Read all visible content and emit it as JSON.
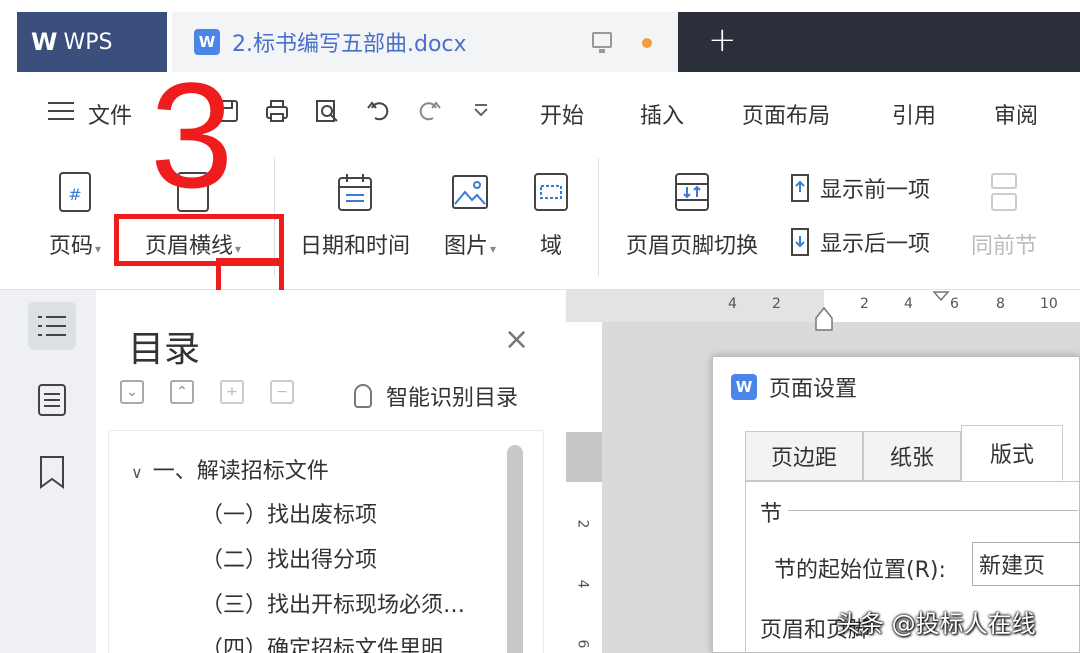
{
  "titlebar": {
    "app_name": "WPS",
    "doc_tab": "2.标书编写五部曲.docx",
    "new_tab": "+"
  },
  "menu": {
    "file": "文件",
    "tabs": [
      "开始",
      "插入",
      "页面布局",
      "引用",
      "审阅"
    ]
  },
  "ribbon": {
    "page_number": "页码",
    "header_line": "页眉横线",
    "date_time": "日期和时间",
    "picture": "图片",
    "field": "域",
    "header_footer_switch": "页眉页脚切换",
    "show_prev": "显示前一项",
    "show_next": "显示后一项",
    "same_as_prev": "同前节"
  },
  "annotation": {
    "step": "3"
  },
  "toc": {
    "title": "目录",
    "close": "×",
    "smart_toc": "智能识别目录",
    "items": [
      "一、解读招标文件",
      "（一）找出废标项",
      "（二）找出得分项",
      "（三）找出开标现场必须…",
      "（四）确定招标文件里明…"
    ]
  },
  "ruler": {
    "h_ticks": [
      "4",
      "2",
      "2",
      "4",
      "6",
      "8",
      "10"
    ],
    "v_ticks": [
      "2",
      "4",
      "6"
    ]
  },
  "dialog": {
    "title": "页面设置",
    "tabs": [
      "页边距",
      "纸张",
      "版式"
    ],
    "active_tab": "版式",
    "section": "节",
    "start_label": "节的起始位置(R):",
    "start_value": "新建页",
    "section2": "页眉和页脚"
  },
  "watermark": "头条 @投标人在线",
  "colors": {
    "annotation_red": "#ee1c1c",
    "wps_blue": "#3b4f7d",
    "accent": "#4a86e8"
  }
}
